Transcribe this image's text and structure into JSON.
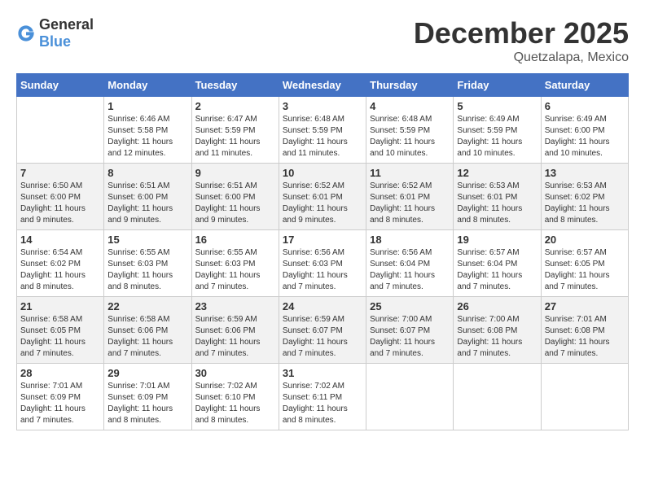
{
  "header": {
    "logo_general": "General",
    "logo_blue": "Blue",
    "month_year": "December 2025",
    "location": "Quetzalapa, Mexico"
  },
  "calendar": {
    "days_of_week": [
      "Sunday",
      "Monday",
      "Tuesday",
      "Wednesday",
      "Thursday",
      "Friday",
      "Saturday"
    ],
    "weeks": [
      [
        {
          "day": "",
          "info": ""
        },
        {
          "day": "1",
          "info": "Sunrise: 6:46 AM\nSunset: 5:58 PM\nDaylight: 11 hours\nand 12 minutes."
        },
        {
          "day": "2",
          "info": "Sunrise: 6:47 AM\nSunset: 5:59 PM\nDaylight: 11 hours\nand 11 minutes."
        },
        {
          "day": "3",
          "info": "Sunrise: 6:48 AM\nSunset: 5:59 PM\nDaylight: 11 hours\nand 11 minutes."
        },
        {
          "day": "4",
          "info": "Sunrise: 6:48 AM\nSunset: 5:59 PM\nDaylight: 11 hours\nand 10 minutes."
        },
        {
          "day": "5",
          "info": "Sunrise: 6:49 AM\nSunset: 5:59 PM\nDaylight: 11 hours\nand 10 minutes."
        },
        {
          "day": "6",
          "info": "Sunrise: 6:49 AM\nSunset: 6:00 PM\nDaylight: 11 hours\nand 10 minutes."
        }
      ],
      [
        {
          "day": "7",
          "info": "Sunrise: 6:50 AM\nSunset: 6:00 PM\nDaylight: 11 hours\nand 9 minutes."
        },
        {
          "day": "8",
          "info": "Sunrise: 6:51 AM\nSunset: 6:00 PM\nDaylight: 11 hours\nand 9 minutes."
        },
        {
          "day": "9",
          "info": "Sunrise: 6:51 AM\nSunset: 6:00 PM\nDaylight: 11 hours\nand 9 minutes."
        },
        {
          "day": "10",
          "info": "Sunrise: 6:52 AM\nSunset: 6:01 PM\nDaylight: 11 hours\nand 9 minutes."
        },
        {
          "day": "11",
          "info": "Sunrise: 6:52 AM\nSunset: 6:01 PM\nDaylight: 11 hours\nand 8 minutes."
        },
        {
          "day": "12",
          "info": "Sunrise: 6:53 AM\nSunset: 6:01 PM\nDaylight: 11 hours\nand 8 minutes."
        },
        {
          "day": "13",
          "info": "Sunrise: 6:53 AM\nSunset: 6:02 PM\nDaylight: 11 hours\nand 8 minutes."
        }
      ],
      [
        {
          "day": "14",
          "info": "Sunrise: 6:54 AM\nSunset: 6:02 PM\nDaylight: 11 hours\nand 8 minutes."
        },
        {
          "day": "15",
          "info": "Sunrise: 6:55 AM\nSunset: 6:03 PM\nDaylight: 11 hours\nand 8 minutes."
        },
        {
          "day": "16",
          "info": "Sunrise: 6:55 AM\nSunset: 6:03 PM\nDaylight: 11 hours\nand 7 minutes."
        },
        {
          "day": "17",
          "info": "Sunrise: 6:56 AM\nSunset: 6:03 PM\nDaylight: 11 hours\nand 7 minutes."
        },
        {
          "day": "18",
          "info": "Sunrise: 6:56 AM\nSunset: 6:04 PM\nDaylight: 11 hours\nand 7 minutes."
        },
        {
          "day": "19",
          "info": "Sunrise: 6:57 AM\nSunset: 6:04 PM\nDaylight: 11 hours\nand 7 minutes."
        },
        {
          "day": "20",
          "info": "Sunrise: 6:57 AM\nSunset: 6:05 PM\nDaylight: 11 hours\nand 7 minutes."
        }
      ],
      [
        {
          "day": "21",
          "info": "Sunrise: 6:58 AM\nSunset: 6:05 PM\nDaylight: 11 hours\nand 7 minutes."
        },
        {
          "day": "22",
          "info": "Sunrise: 6:58 AM\nSunset: 6:06 PM\nDaylight: 11 hours\nand 7 minutes."
        },
        {
          "day": "23",
          "info": "Sunrise: 6:59 AM\nSunset: 6:06 PM\nDaylight: 11 hours\nand 7 minutes."
        },
        {
          "day": "24",
          "info": "Sunrise: 6:59 AM\nSunset: 6:07 PM\nDaylight: 11 hours\nand 7 minutes."
        },
        {
          "day": "25",
          "info": "Sunrise: 7:00 AM\nSunset: 6:07 PM\nDaylight: 11 hours\nand 7 minutes."
        },
        {
          "day": "26",
          "info": "Sunrise: 7:00 AM\nSunset: 6:08 PM\nDaylight: 11 hours\nand 7 minutes."
        },
        {
          "day": "27",
          "info": "Sunrise: 7:01 AM\nSunset: 6:08 PM\nDaylight: 11 hours\nand 7 minutes."
        }
      ],
      [
        {
          "day": "28",
          "info": "Sunrise: 7:01 AM\nSunset: 6:09 PM\nDaylight: 11 hours\nand 7 minutes."
        },
        {
          "day": "29",
          "info": "Sunrise: 7:01 AM\nSunset: 6:09 PM\nDaylight: 11 hours\nand 8 minutes."
        },
        {
          "day": "30",
          "info": "Sunrise: 7:02 AM\nSunset: 6:10 PM\nDaylight: 11 hours\nand 8 minutes."
        },
        {
          "day": "31",
          "info": "Sunrise: 7:02 AM\nSunset: 6:11 PM\nDaylight: 11 hours\nand 8 minutes."
        },
        {
          "day": "",
          "info": ""
        },
        {
          "day": "",
          "info": ""
        },
        {
          "day": "",
          "info": ""
        }
      ]
    ]
  }
}
